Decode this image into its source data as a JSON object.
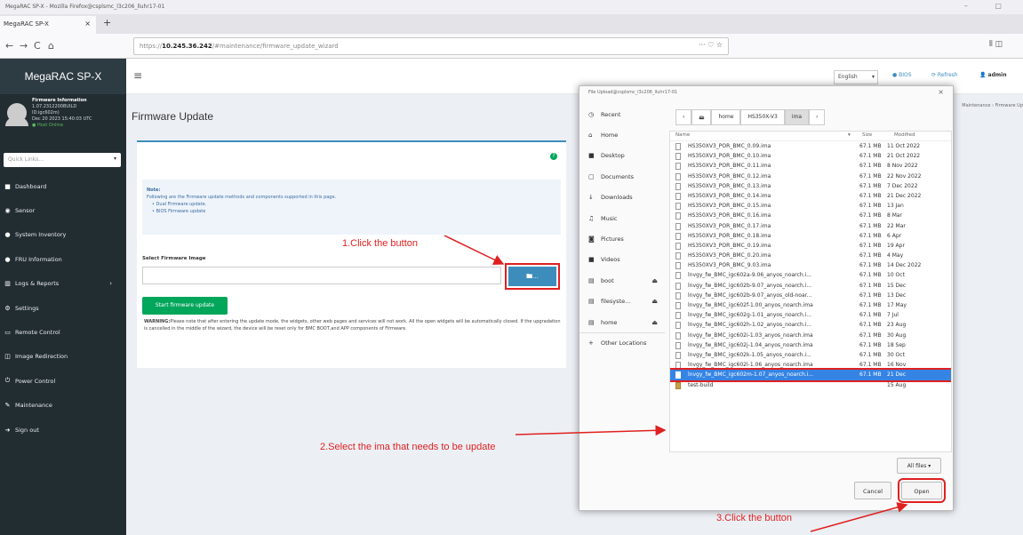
{
  "window": {
    "title": "MegaRAC SP-X - Mozilla Firefox@csplsmc_l3c206_lluhr17-01",
    "controls": "–  ▢"
  },
  "tab": {
    "label": "MegaRAC SP-X",
    "close": "×",
    "new": "+"
  },
  "nav": {
    "back": "←",
    "forward": "→",
    "reload": "C",
    "home": "⌂",
    "url_prefix": "https://",
    "url_host": "10.245.36.242",
    "url_path": "/#maintenance/firmware_update_wizard",
    "more": "··· ♡ ☆",
    "library": "⫴ ◫"
  },
  "sidebar": {
    "brand": "MegaRAC SP-X",
    "user": {
      "title": "Firmware Information",
      "version": "1.07.2312200BUILD",
      "build": "ID:igc602m)",
      "date": "Dec 20 2023 15:40:03 UTC",
      "status": "● Host Online"
    },
    "quicklinks": "Quick Links...",
    "items": [
      {
        "icon": "■",
        "label": "Dashboard"
      },
      {
        "icon": "◉",
        "label": "Sensor"
      },
      {
        "icon": "●",
        "label": "System Inventory"
      },
      {
        "icon": "●",
        "label": "FRU Information"
      },
      {
        "icon": "▥",
        "label": "Logs & Reports",
        "arrow": "›"
      },
      {
        "icon": "⚙",
        "label": "Settings"
      },
      {
        "icon": "▭",
        "label": "Remote Control"
      },
      {
        "icon": "◫",
        "label": "Image Redirection"
      },
      {
        "icon": "⏻",
        "label": "Power Control"
      },
      {
        "icon": "✎",
        "label": "Maintenance"
      },
      {
        "icon": "➔",
        "label": "Sign out"
      }
    ]
  },
  "topbar": {
    "hamburger": "≡",
    "language": "English",
    "bios": "● BIOS",
    "refresh": "⟳ Refresh",
    "user": "👤 admin"
  },
  "page": {
    "title": "Firmware Update",
    "breadcrumb": "Maintenance › Firmware Up",
    "help": "?",
    "note_title": "Note:",
    "note_text": "Following are the Firmware update methods and components supported in this page.",
    "note_items": [
      "Dual Firmware update.",
      "BIOS Firmware update"
    ],
    "select_label": "Select Firmware Image",
    "browse": "🖿...",
    "start": "Start firmware update",
    "warning_bold": "WARNING:",
    "warning": "Please note that after entering the update mode, the widgets, other web pages and services will not work. All the open widgets will be automatically closed. If the upgradation is cancelled in the middle of the wizard, the device will be reset only for BMC BOOT,and APP components of Firmware."
  },
  "dialog": {
    "title": "File Upload@csplsmc_l3c206_lluhr17-01",
    "close": "×",
    "places": [
      {
        "icon": "◷",
        "label": "Recent"
      },
      {
        "icon": "⌂",
        "label": "Home"
      },
      {
        "icon": "■",
        "label": "Desktop"
      },
      {
        "icon": "▢",
        "label": "Documents"
      },
      {
        "icon": "↓",
        "label": "Downloads"
      },
      {
        "icon": "♫",
        "label": "Music"
      },
      {
        "icon": "◙",
        "label": "Pictures"
      },
      {
        "icon": "■",
        "label": "Videos"
      },
      {
        "icon": "▤",
        "label": "boot",
        "eject": "⏏"
      },
      {
        "icon": "▤",
        "label": "filesyste...",
        "eject": "⏏"
      },
      {
        "icon": "▤",
        "label": "home",
        "eject": "⏏"
      },
      {
        "icon": "+",
        "label": "Other Locations"
      }
    ],
    "path": [
      "‹",
      "🖴",
      "home",
      "HS350X-V3",
      "ima",
      "›"
    ],
    "columns": {
      "name": "Name",
      "sort": "▾",
      "size": "Size",
      "modified": "Modified"
    },
    "files": [
      {
        "name": "HS350XV3_POR_BMC_0.09.ima",
        "size": "67.1 MB",
        "modified": "11 Oct 2022"
      },
      {
        "name": "HS350XV3_POR_BMC_0.10.ima",
        "size": "67.1 MB",
        "modified": "21 Oct 2022"
      },
      {
        "name": "HS350XV3_POR_BMC_0.11.ima",
        "size": "67.1 MB",
        "modified": "8 Nov 2022"
      },
      {
        "name": "HS350XV3_POR_BMC_0.12.ima",
        "size": "67.1 MB",
        "modified": "22 Nov 2022"
      },
      {
        "name": "HS350XV3_POR_BMC_0.13.ima",
        "size": "67.1 MB",
        "modified": "7 Dec 2022"
      },
      {
        "name": "HS350XV3_POR_BMC_0.14.ima",
        "size": "67.1 MB",
        "modified": "21 Dec 2022"
      },
      {
        "name": "HS350XV3_POR_BMC_0.15.ima",
        "size": "67.1 MB",
        "modified": "13 Jan"
      },
      {
        "name": "HS350XV3_POR_BMC_0.16.ima",
        "size": "67.1 MB",
        "modified": "8 Mar"
      },
      {
        "name": "HS350XV3_POR_BMC_0.17.ima",
        "size": "67.1 MB",
        "modified": "22 Mar"
      },
      {
        "name": "HS350XV3_POR_BMC_0.18.ima",
        "size": "67.1 MB",
        "modified": "6 Apr"
      },
      {
        "name": "HS350XV3_POR_BMC_0.19.ima",
        "size": "67.1 MB",
        "modified": "19 Apr"
      },
      {
        "name": "HS350XV3_POR_BMC_0.20.ima",
        "size": "67.1 MB",
        "modified": "4 May"
      },
      {
        "name": "HS350XV3_POR_BMC_9.03.ima",
        "size": "67.1 MB",
        "modified": "14 Dec 2022"
      },
      {
        "name": "lnvgy_fw_BMC_igc602a-9.06_anyos_noarch.i...",
        "size": "67.1 MB",
        "modified": "10 Oct"
      },
      {
        "name": "lnvgy_fw_BMC_igc602b-9.07_anyos_noarch.i...",
        "size": "67.1 MB",
        "modified": "15 Dec"
      },
      {
        "name": "lnvgy_fw_BMC_igc602b-9.07_anyos_old-noar...",
        "size": "67.1 MB",
        "modified": "13 Dec"
      },
      {
        "name": "lnvgy_fw_BMC_igc602f-1.00_anyos_noarch.ima",
        "size": "67.1 MB",
        "modified": "17 May"
      },
      {
        "name": "lnvgy_fw_BMC_igc602g-1.01_anyos_noarch.i...",
        "size": "67.1 MB",
        "modified": "7 Jul"
      },
      {
        "name": "lnvgy_fw_BMC_igc602h-1.02_anyos_noarch.i...",
        "size": "67.1 MB",
        "modified": "23 Aug"
      },
      {
        "name": "lnvgy_fw_BMC_igc602i-1.03_anyos_noarch.ima",
        "size": "67.1 MB",
        "modified": "30 Aug"
      },
      {
        "name": "lnvgy_fw_BMC_igc602j-1.04_anyos_noarch.ima",
        "size": "67.1 MB",
        "modified": "18 Sep"
      },
      {
        "name": "lnvgy_fw_BMC_igc602k-1.05_anyos_noarch.i...",
        "size": "67.1 MB",
        "modified": "30 Oct"
      },
      {
        "name": "lnvgy_fw_BMC_igc602l-1.06_anyos_noarch.ima",
        "size": "67.1 MB",
        "modified": "16 Nov"
      },
      {
        "name": "lnvgy_fw_BMC_igc602m-1.07_anyos_noarch.i...",
        "size": "67.1 MB",
        "modified": "21 Dec",
        "selected": true
      },
      {
        "name": "test-build",
        "size": "",
        "modified": "15 Aug",
        "folder": true
      }
    ],
    "filter": "All files ▾",
    "cancel": "Cancel",
    "open": "Open"
  },
  "annotations": {
    "step1": "1.Click the button",
    "step2": "2.Select the ima that needs to be update",
    "step3": "3.Click the button",
    "color": "#e02020"
  }
}
